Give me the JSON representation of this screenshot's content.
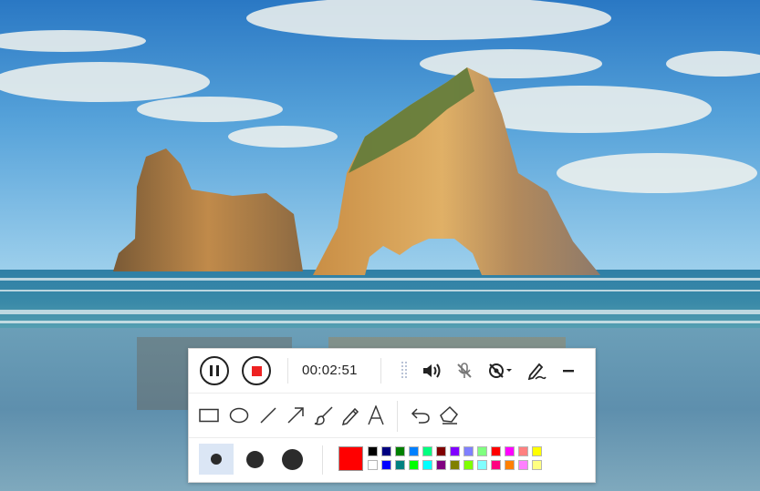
{
  "recorder": {
    "elapsed_time": "00:02:51",
    "icons": {
      "pause": "pause-icon",
      "stop": "stop-icon",
      "drag_handle": "drag-handle-icon",
      "volume": "volume-icon",
      "microphone_muted": "microphone-off-icon",
      "camera_off": "webcam-off-icon",
      "annotate": "pen-annotate-icon",
      "minimize": "minimize-icon"
    },
    "stop_color": "#ee2222"
  },
  "draw_tools": [
    "rectangle-icon",
    "ellipse-icon",
    "line-icon",
    "arrow-icon",
    "brush-icon",
    "pencil-icon",
    "text-icon",
    "undo-icon",
    "eraser-icon"
  ],
  "brush_sizes": [
    {
      "name": "small",
      "selected": true
    },
    {
      "name": "medium",
      "selected": false
    },
    {
      "name": "large",
      "selected": false
    }
  ],
  "current_color": "#ff0000",
  "palette": [
    "#000000",
    "#000080",
    "#008000",
    "#0080ff",
    "#00ff80",
    "#800000",
    "#8000ff",
    "#8080ff",
    "#80ff80",
    "#ff0000",
    "#ff00ff",
    "#ff8080",
    "#ffff00",
    "#ffffff",
    "#0000ff",
    "#008080",
    "#00ff00",
    "#00ffff",
    "#800080",
    "#808000",
    "#80ff00",
    "#80ffff",
    "#ff0080",
    "#ff8000",
    "#ff80ff",
    "#ffff80"
  ]
}
